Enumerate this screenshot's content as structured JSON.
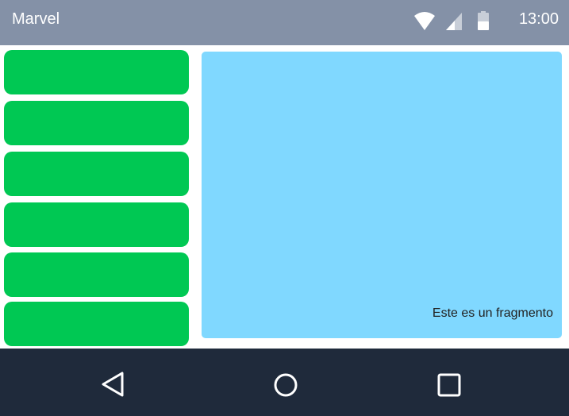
{
  "status_bar": {
    "app_title": "Marvel",
    "time": "13:00",
    "icons": [
      "wifi-icon",
      "signal-icon",
      "battery-icon"
    ],
    "background_color": "#8491a7"
  },
  "main": {
    "buttons": [
      {
        "label": ""
      },
      {
        "label": ""
      },
      {
        "label": ""
      },
      {
        "label": ""
      },
      {
        "label": ""
      },
      {
        "label": ""
      }
    ],
    "button_color": "#00c853",
    "fragment": {
      "text": "Este es un fragmento",
      "background_color": "#80d8ff"
    }
  },
  "nav_bar": {
    "icons": [
      "back-icon",
      "home-icon",
      "recents-icon"
    ],
    "background_color": "#1f2a3b"
  }
}
